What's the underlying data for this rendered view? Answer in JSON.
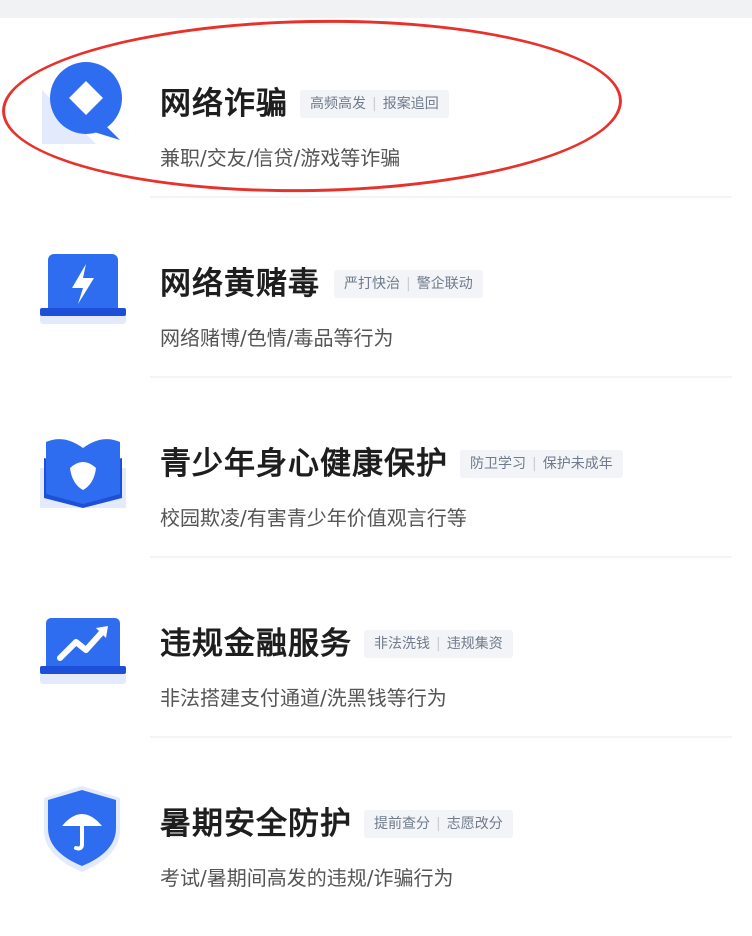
{
  "colors": {
    "accent": "#2f6df0",
    "accent_dark": "#1e4fd8",
    "highlight": "#e8312b",
    "tag_bg": "#f2f4f7",
    "tag_text": "#6f7a8b"
  },
  "items": [
    {
      "title": "网络诈骗",
      "tag1": "高频高发",
      "tag2": "报案追回",
      "desc": "兼职/交友/信贷/游戏等诈骗",
      "icon": "chat-diamond-icon"
    },
    {
      "title": "网络黄赌毒",
      "tag1": "严打快治",
      "tag2": "警企联动",
      "desc": "网络赌博/色情/毒品等行为",
      "icon": "lightning-laptop-icon"
    },
    {
      "title": "青少年身心健康保护",
      "tag1": "防卫学习",
      "tag2": "保护未成年",
      "desc": "校园欺凌/有害青少年价值观言行等",
      "icon": "heart-book-icon"
    },
    {
      "title": "违规金融服务",
      "tag1": "非法洗钱",
      "tag2": "违规集资",
      "desc": "非法搭建支付通道/洗黑钱等行为",
      "icon": "trend-laptop-icon"
    },
    {
      "title": "暑期安全防护",
      "tag1": "提前查分",
      "tag2": "志愿改分",
      "desc": "考试/暑期间高发的违规/诈骗行为",
      "icon": "umbrella-shield-icon"
    }
  ]
}
